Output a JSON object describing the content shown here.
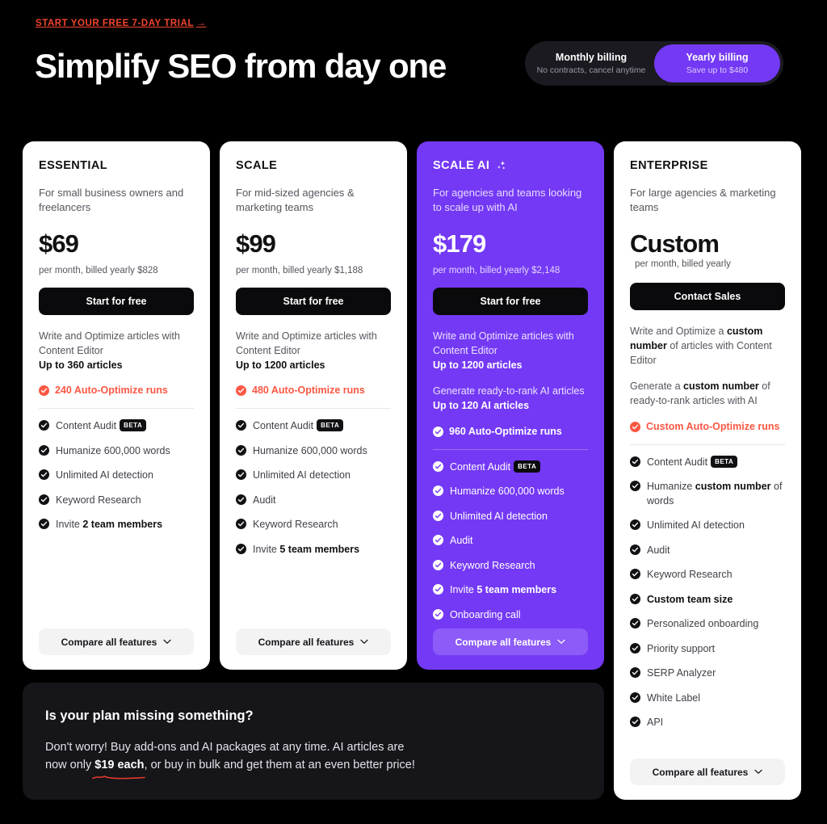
{
  "header": {
    "trial_link": "START YOUR FREE 7-DAY TRIAL",
    "trial_arrow": "→",
    "headline": "Simplify SEO from day one"
  },
  "billing_toggle": {
    "monthly": {
      "title": "Monthly billing",
      "subtitle": "No contracts, cancel anytime"
    },
    "yearly": {
      "title": "Yearly billing",
      "subtitle": "Save up to $480",
      "active": true
    }
  },
  "colors": {
    "page_bg": "#000000",
    "accent_purple": "#7439F5",
    "accent_red": "#FA5743",
    "card_bg": "#FFFFFF",
    "promo_bg": "#161519"
  },
  "plans": [
    {
      "id": "essential",
      "name": "ESSENTIAL",
      "description": "For small business owners and freelancers",
      "price": "$69",
      "price_note": "per month, billed yearly $828",
      "cta": "Start for free",
      "desc_blocks": [
        {
          "text": "Write and Optimize articles with Content Editor",
          "bold": "Up to 360 articles"
        }
      ],
      "highlight": "240 Auto-Optimize runs",
      "features": [
        {
          "label": "Content Audit",
          "badge": "BETA"
        },
        {
          "label": "Humanize 600,000 words"
        },
        {
          "label": "Unlimited AI detection"
        },
        {
          "label": "Keyword Research"
        },
        {
          "label": "Invite ",
          "bold": "2 team members"
        }
      ],
      "compare": "Compare all features"
    },
    {
      "id": "scale",
      "name": "SCALE",
      "description": "For mid-sized agencies & marketing teams",
      "price": "$99",
      "price_note": "per month, billed yearly $1,188",
      "cta": "Start for free",
      "desc_blocks": [
        {
          "text": "Write and Optimize articles with Content Editor",
          "bold": "Up to 1200 articles"
        }
      ],
      "highlight": "480 Auto-Optimize runs",
      "features": [
        {
          "label": "Content Audit",
          "badge": "BETA"
        },
        {
          "label": "Humanize 600,000 words"
        },
        {
          "label": "Unlimited AI detection"
        },
        {
          "label": "Audit"
        },
        {
          "label": "Keyword Research"
        },
        {
          "label": "Invite ",
          "bold": "5 team members"
        }
      ],
      "compare": "Compare all features"
    },
    {
      "id": "scaleai",
      "name": "SCALE AI",
      "icon": "sparkle-icon",
      "featured": true,
      "description": "For agencies and teams looking to scale up with AI",
      "price": "$179",
      "price_note": "per month, billed yearly $2,148",
      "cta": "Start for free",
      "desc_blocks": [
        {
          "text": "Write and Optimize articles with Content Editor",
          "bold": "Up to 1200 articles"
        },
        {
          "text": "Generate ready-to-rank AI articles",
          "bold": "Up to 120 AI articles"
        }
      ],
      "highlight": "960 Auto-Optimize runs",
      "features": [
        {
          "label": "Content Audit",
          "badge": "BETA"
        },
        {
          "label": "Humanize 600,000 words"
        },
        {
          "label": "Unlimited AI detection"
        },
        {
          "label": "Audit"
        },
        {
          "label": "Keyword Research"
        },
        {
          "label": "Invite ",
          "bold": "5 team members"
        },
        {
          "label": "Onboarding call"
        }
      ],
      "compare": "Compare all features"
    },
    {
      "id": "enterprise",
      "name": "ENTERPRISE",
      "description": "For large agencies & marketing teams",
      "price": "Custom",
      "price_note": "per month, billed yearly",
      "cta": "Contact Sales",
      "desc_blocks": [
        {
          "pre": "Write and Optimize a ",
          "bold_inline": "custom number",
          "post": " of articles with Content Editor"
        },
        {
          "pre": "Generate a ",
          "bold_inline": "custom number",
          "post": " of ready-to-rank articles with AI"
        }
      ],
      "highlight": "Custom Auto-Optimize runs",
      "features": [
        {
          "label": "Content Audit",
          "badge": "BETA"
        },
        {
          "pre": "Humanize ",
          "bold": "custom number",
          "post": " of words"
        },
        {
          "label": "Unlimited AI detection"
        },
        {
          "label": "Audit"
        },
        {
          "label": "Keyword Research"
        },
        {
          "label": "Custom team size",
          "strong": true
        },
        {
          "label": "Personalized onboarding"
        },
        {
          "label": "Priority support"
        },
        {
          "label": "SERP Analyzer"
        },
        {
          "label": "White Label"
        },
        {
          "label": "API"
        }
      ],
      "compare": "Compare all features"
    }
  ],
  "promo": {
    "title": "Is your plan missing something?",
    "line1": "Don't worry! Buy add-ons and AI packages at any time. AI articles are",
    "line2_pre": "now only ",
    "line2_highlight": "$19 each",
    "line2_post": ", or buy in bulk and get them at an even better price!"
  }
}
